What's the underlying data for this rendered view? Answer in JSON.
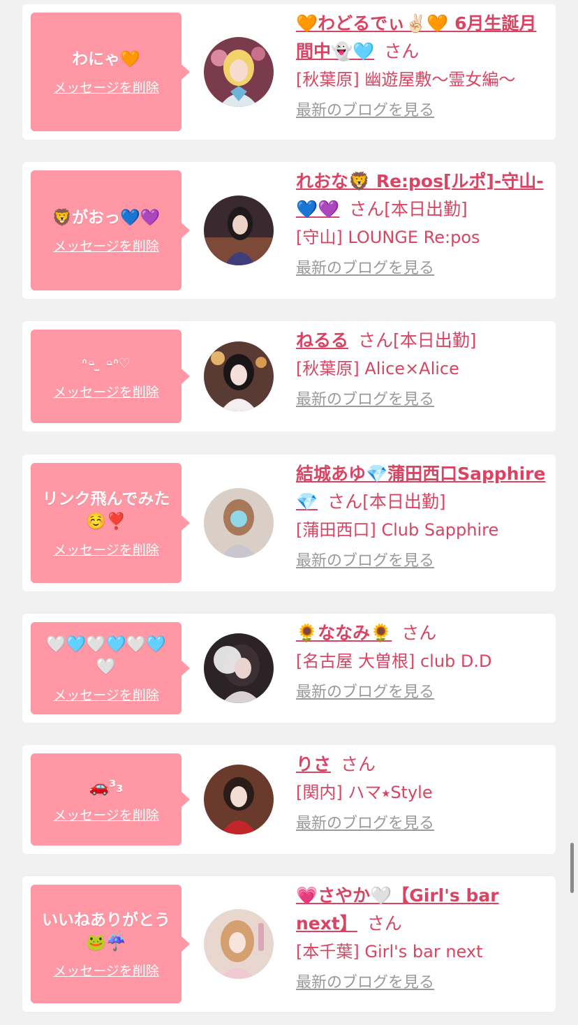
{
  "delete_label": "メッセージを削除",
  "san_label": "さん",
  "blog_label": "最新のブログを見る",
  "colors": {
    "bubble": "#ff97a5",
    "name": "#d94463",
    "link_gray": "#9a9a9a",
    "card": "#ffffff",
    "page_bg": "#f1f1f1"
  },
  "messages": [
    {
      "text": "わにゃ🧡",
      "name": "🧡わどるでぃ✌🏻🧡 6月生誕月間中👻🩵",
      "status": "",
      "shop": "[秋葉原] 幽遊屋敷〜霊女編〜"
    },
    {
      "text": "🦁がおっ💙💜",
      "name": "れおな🦁 Re:pos[ルポ]-守山-💙💜",
      "status": "[本日出勤]",
      "shop": "[守山] LOUNGE Re:pos"
    },
    {
      "text": "ᐢ◦̵ ̫ ◦̵ᐢ♡",
      "name": "ねるる",
      "status": "[本日出勤]",
      "shop": "[秋葉原] Alice×Alice"
    },
    {
      "text": "リンク飛んでみた☺️❣️",
      "name": "結城あゆ💎蒲田西口Sapphire💎",
      "status": "[本日出勤]",
      "shop": "[蒲田西口] Club Sapphire"
    },
    {
      "text": "🤍🩵🤍🩵🤍🩵🤍",
      "name": "🌻ななみ🌻",
      "status": "",
      "shop": "[名古屋 大曽根] club D.D"
    },
    {
      "text": "🚗³₃",
      "name": "りさ",
      "status": "",
      "shop": "[関内] ハマ⭑Style"
    },
    {
      "text": "いいねありがとう🐸☔️",
      "name": "💗さやか🤍【Girl's bar next】",
      "status": "",
      "shop": "[本千葉] Girl's bar next"
    }
  ]
}
